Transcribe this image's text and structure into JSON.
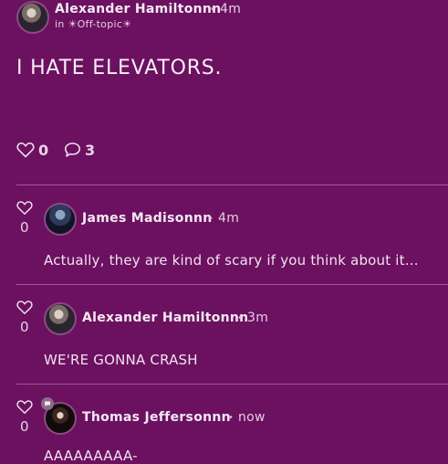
{
  "post": {
    "author": "Alexander Hamiltonnn",
    "time": "4m",
    "dot": "•",
    "in_prefix": "in",
    "channel": "☀Off-topic☀",
    "title": "I HATE ELEVATORS.",
    "likes": "0",
    "comments": "3"
  },
  "replies": [
    {
      "author": "James Madisonnn",
      "time": "4m",
      "text": "Actually, they are kind of scary if you think about it...",
      "likes": "0"
    },
    {
      "author": "Alexander Hamiltonnn",
      "time": "3m",
      "text": "WE'RE GONNA CRASH",
      "likes": "0"
    },
    {
      "author": "Thomas Jeffersonnn",
      "time": "now",
      "text": "AAAAAAAAA-",
      "likes": "0"
    }
  ],
  "icons": {
    "like": "heart-outline-icon",
    "comment": "speech-bubble-icon",
    "badge": "chat-badge-icon"
  },
  "colors": {
    "background": "#6b1160",
    "divider": "#9c5a92",
    "text": "#f3e8f1"
  }
}
